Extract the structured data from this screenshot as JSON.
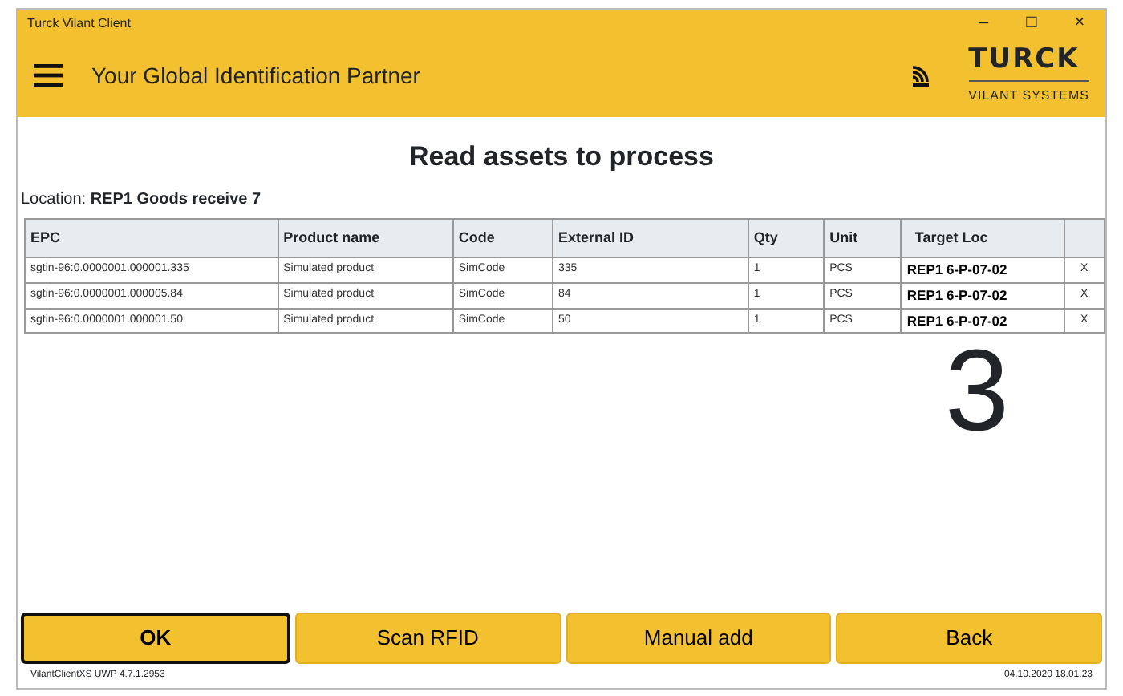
{
  "window": {
    "title": "Turck Vilant Client",
    "controls": [
      "–",
      "□",
      "×"
    ]
  },
  "header": {
    "tagline": "Your Global Identification Partner",
    "logo": {
      "brand": "TURCK",
      "subtitle": "VILANT SYSTEMS"
    }
  },
  "page_title": "Read assets to process",
  "location": {
    "label": "Location:",
    "value": "REP1 Goods receive 7"
  },
  "table": {
    "columns": [
      "EPC",
      "Product name",
      "Code",
      "External ID",
      "Qty",
      "Unit",
      "Target Loc",
      ""
    ],
    "rows": [
      {
        "epc": "sgtin-96:0.0000001.000001.335",
        "product": "Simulated product",
        "code": "SimCode",
        "external_id": "335",
        "qty": "1",
        "unit": "PCS",
        "target": "REP1 6-P-07-02",
        "remove": "X"
      },
      {
        "epc": "sgtin-96:0.0000001.000005.84",
        "product": "Simulated product",
        "code": "SimCode",
        "external_id": "84",
        "qty": "1",
        "unit": "PCS",
        "target": "REP1 6-P-07-02",
        "remove": "X"
      },
      {
        "epc": "sgtin-96:0.0000001.000001.50",
        "product": "Simulated product",
        "code": "SimCode",
        "external_id": "50",
        "qty": "1",
        "unit": "PCS",
        "target": "REP1 6-P-07-02",
        "remove": "X"
      }
    ]
  },
  "count": "3",
  "buttons": [
    {
      "label": "OK",
      "selected": true
    },
    {
      "label": "Scan RFID",
      "selected": false
    },
    {
      "label": "Manual add",
      "selected": false
    },
    {
      "label": "Back",
      "selected": false
    }
  ],
  "status_bar": {
    "version": "VilantClientXS UWP 4.7.1.2953",
    "timestamp": "04.10.2020 18.01.23"
  }
}
